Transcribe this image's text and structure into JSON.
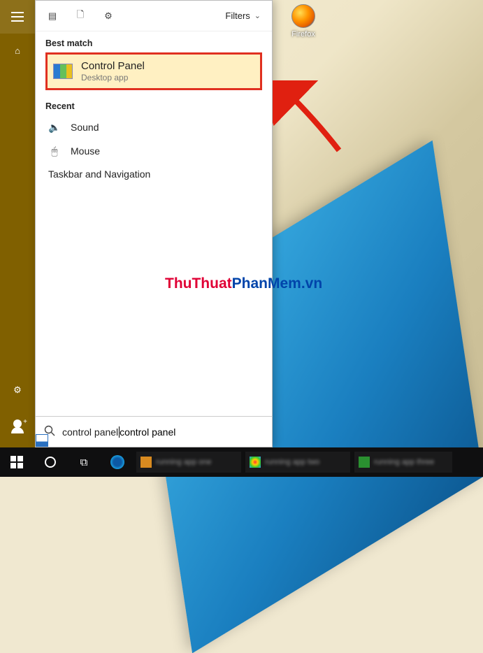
{
  "desktop": {
    "icons": [
      {
        "name": "Firefox"
      }
    ]
  },
  "rail": {
    "menu": "Menu",
    "home": "Home",
    "settings": "Settings",
    "account": "Account"
  },
  "panel": {
    "toolbar": {
      "filters": "Filters"
    },
    "best_match_hdr": "Best match",
    "top": {
      "title": "Control Panel",
      "subtitle": "Desktop app"
    },
    "recent_hdr": "Recent",
    "recent": [
      {
        "icon": "speaker",
        "label": "Sound"
      },
      {
        "icon": "mouse",
        "label": "Mouse"
      },
      {
        "icon": "taskbar",
        "label": "Taskbar and Navigation"
      }
    ],
    "search_value": "control panel"
  },
  "watermark": {
    "part1": "ThuThuat",
    "part2": "PhanMem.vn"
  },
  "taskbar": {
    "start": "Start",
    "cortana": "Cortana",
    "taskview": "Task View",
    "edge": "Microsoft Edge"
  }
}
